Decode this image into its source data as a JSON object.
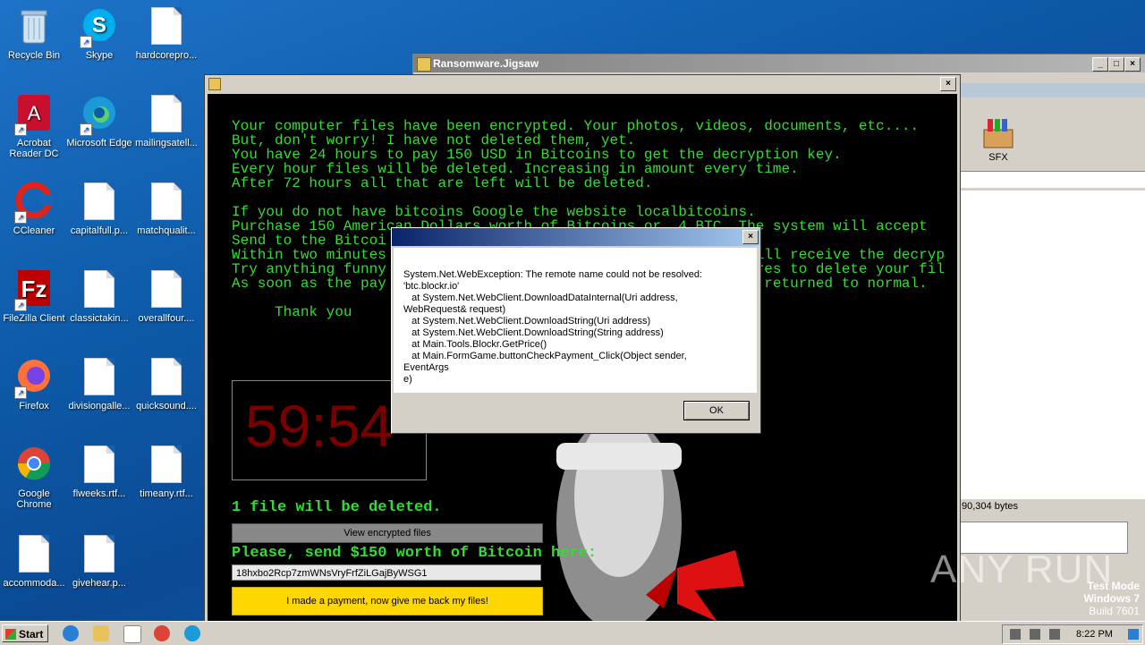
{
  "desktop": {
    "icons": [
      {
        "label": "Recycle Bin"
      },
      {
        "label": "Skype"
      },
      {
        "label": "hardcorepro..."
      },
      {
        "label": "Acrobat Reader DC"
      },
      {
        "label": "Microsoft Edge"
      },
      {
        "label": "mailingsatell..."
      },
      {
        "label": "CCleaner"
      },
      {
        "label": "capitalfull.p..."
      },
      {
        "label": "matchqualit..."
      },
      {
        "label": "FileZilla Client"
      },
      {
        "label": "classictakin..."
      },
      {
        "label": "overallfour...."
      },
      {
        "label": "Firefox"
      },
      {
        "label": "divisiongalle..."
      },
      {
        "label": "quicksound...."
      },
      {
        "label": "Google Chrome"
      },
      {
        "label": "flweeks.rtf..."
      },
      {
        "label": "timeany.rtf..."
      },
      {
        "label": "accommoda..."
      },
      {
        "label": "givehear.p..."
      }
    ],
    "watermark": "ANY RUN",
    "test_mode": {
      "line1": "Test Mode",
      "line2": "Windows 7",
      "line3": "Build 7601"
    }
  },
  "back_window": {
    "title": "Ransomware.Jigsaw",
    "sfx_label": "SFX",
    "partial_label": "nt",
    "status_bytes": "90,304 bytes"
  },
  "ransom_window": {
    "lines": "Your computer files have been encrypted. Your photos, videos, documents, etc....\nBut, don't worry! I have not deleted them, yet.\nYou have 24 hours to pay 150 USD in Bitcoins to get the decryption key.\nEvery hour files will be deleted. Increasing in amount every time.\nAfter 72 hours all that are left will be deleted.\n\nIf you do not have bitcoins Google the website localbitcoins.\nPurchase 150 American Dollars worth of Bitcoins or .4 BTC. The system will accept\nSend to the Bitcoi                                             \nWithin two minutes                                          will receive the decryp\nTry anything funny                                          ures to delete your fil\nAs soon as the pay                                          e returned to normal.\n\n     Thank you",
    "timer": "59:54",
    "files_deleted": "1 file will be deleted.",
    "view_files_button": "View encrypted files",
    "send_text": "Please, send $150 worth of Bitcoin here:",
    "btc_address": "18hxbo2Rcp7zmWNsVryFrfZiLGajByWSG1",
    "pay_button": "I made a payment, now give me back my files!"
  },
  "dialog": {
    "message": "System.Net.WebException: The remote name could not be resolved:\n'btc.blockr.io'\n   at System.Net.WebClient.DownloadDataInternal(Uri address,\nWebRequest& request)\n   at System.Net.WebClient.DownloadString(Uri address)\n   at System.Net.WebClient.DownloadString(String address)\n   at Main.Tools.Blockr.GetPrice()\n   at Main.FormGame.buttonCheckPayment_Click(Object sender, EventArgs\ne)",
    "ok_label": "OK"
  },
  "taskbar": {
    "start_label": "Start",
    "clock": "8:22 PM"
  }
}
